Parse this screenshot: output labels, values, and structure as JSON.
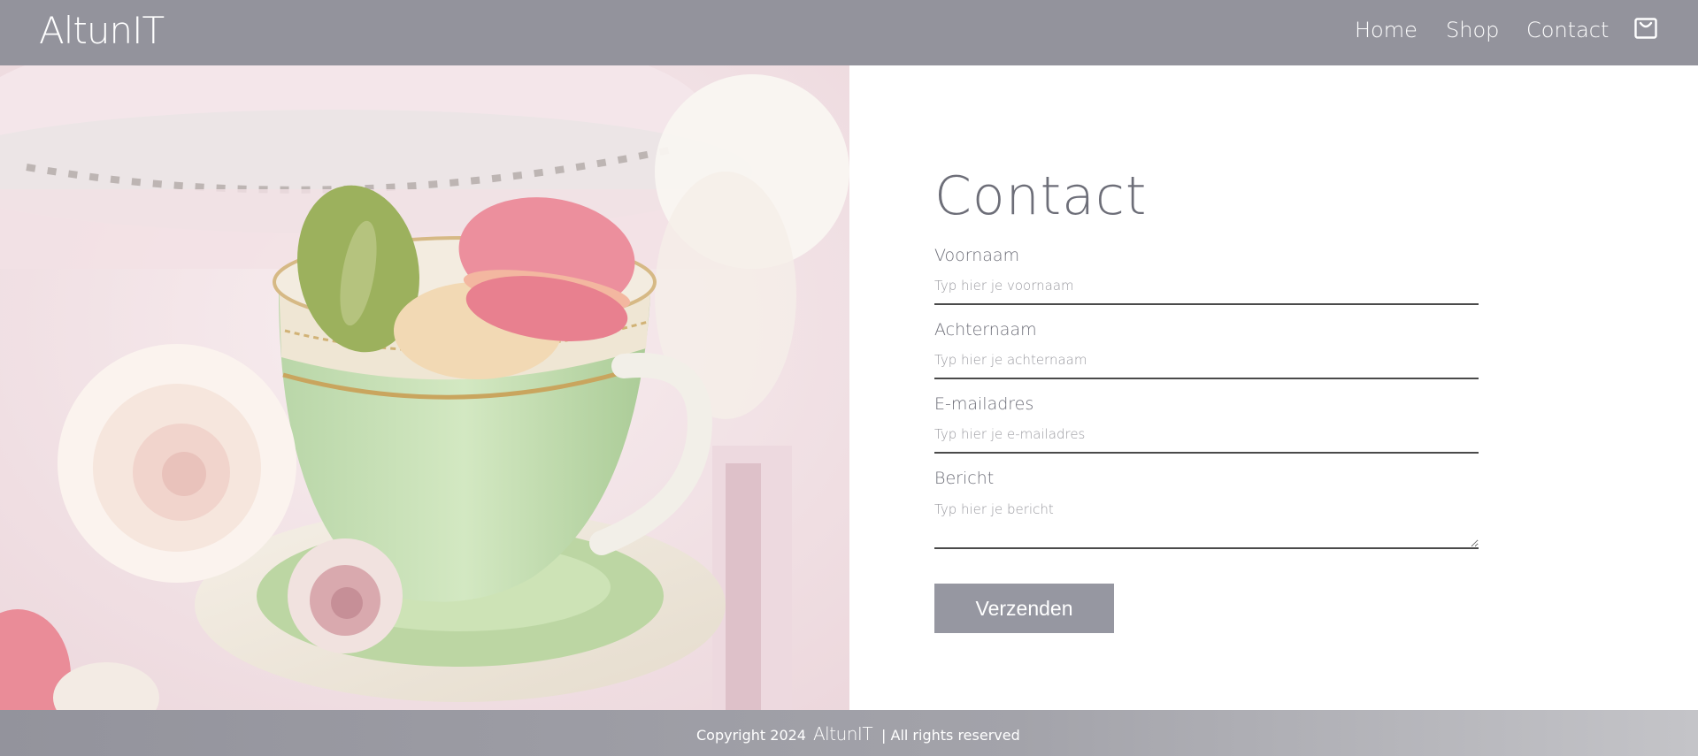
{
  "header": {
    "logo": "AltunIT",
    "nav": {
      "home": "Home",
      "shop": "Shop",
      "contact": "Contact"
    },
    "cart_icon": "shopping-bag-icon",
    "background": "#93939c"
  },
  "hero": {
    "image": "teacup-with-macarons-and-roses"
  },
  "contact": {
    "title": "Contact",
    "fields": {
      "first_name": {
        "label": "Voornaam",
        "placeholder": "Typ hier je voornaam",
        "value": ""
      },
      "last_name": {
        "label": "Achternaam",
        "placeholder": "Typ hier je achternaam",
        "value": ""
      },
      "email": {
        "label": "E-mailadres",
        "placeholder": "Typ hier je e-mailadres",
        "value": ""
      },
      "message": {
        "label": "Bericht",
        "placeholder": "Typ hier je bericht",
        "value": ""
      }
    },
    "submit_label": "Verzenden",
    "button_color": "#9697a1"
  },
  "footer": {
    "copyright": "Copyright 2024",
    "logo": "AltunIT",
    "rights": "| All rights reserved"
  }
}
